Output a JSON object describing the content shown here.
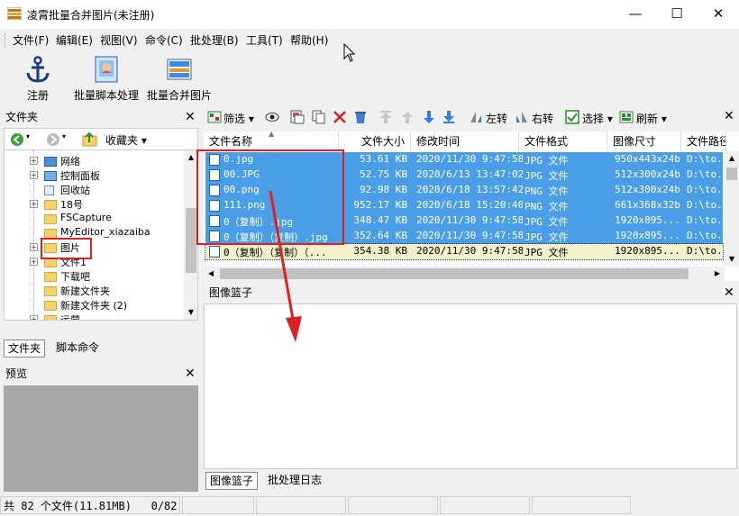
{
  "window": {
    "title": "凌霄批量合并图片(未注册)",
    "minimize": "—",
    "maximize": "☐",
    "close": "✕"
  },
  "menu": [
    "文件(F)",
    "编辑(E)",
    "视图(V)",
    "命令(C)",
    "批处理(B)",
    "工具(T)",
    "帮助(H)"
  ],
  "big_toolbar": {
    "register": "注册",
    "batch_script": "批量脚本处理",
    "batch_merge": "批量合并图片"
  },
  "folder_panel": {
    "title": "文件夹",
    "tree": [
      {
        "label": "网络",
        "expandable": true,
        "icon": "network-icon"
      },
      {
        "label": "控制面板",
        "expandable": true,
        "icon": "control-panel-icon"
      },
      {
        "label": "回收站",
        "expandable": false,
        "icon": "recycle-bin-icon"
      },
      {
        "label": "18号",
        "expandable": true,
        "icon": "folder-icon"
      },
      {
        "label": "FSCapture",
        "expandable": false,
        "icon": "folder-icon"
      },
      {
        "label": "MyEditor_xiazaiba",
        "expandable": false,
        "icon": "folder-icon"
      },
      {
        "label": "图片",
        "expandable": true,
        "icon": "folder-icon"
      },
      {
        "label": "文件1",
        "expandable": true,
        "icon": "folder-icon"
      },
      {
        "label": "下载吧",
        "expandable": false,
        "icon": "folder-icon"
      },
      {
        "label": "新建文件夹",
        "expandable": false,
        "icon": "folder-icon"
      },
      {
        "label": "新建文件夹 (2)",
        "expandable": false,
        "icon": "folder-icon"
      },
      {
        "label": "运营",
        "expandable": true,
        "icon": "folder-icon"
      }
    ],
    "tabs": [
      "文件夹",
      "脚本命令"
    ]
  },
  "preview_panel": {
    "title": "预览"
  },
  "file_toolbar": {
    "filter": "筛选",
    "rotate_left": "左转",
    "rotate_right": "右转",
    "select": "选择",
    "refresh": "刷新"
  },
  "file_list": {
    "columns": [
      "文件名称",
      "文件大小",
      "修改时间",
      "文件格式",
      "图像尺寸",
      "文件路径"
    ],
    "rows": [
      {
        "name": "0.jpg",
        "size": "53.61 KB",
        "modified": "2020/11/30 9:47:58",
        "format": "JPG 文件",
        "dims": "950x443x24b",
        "path": "D:\\to...",
        "state": "selected"
      },
      {
        "name": "00.JPG",
        "size": "52.75 KB",
        "modified": "2020/6/13 13:47:02",
        "format": "JPG 文件",
        "dims": "512x300x24b",
        "path": "D:\\to...",
        "state": "selected"
      },
      {
        "name": "00.png",
        "size": "92.98 KB",
        "modified": "2020/6/18 13:57:42",
        "format": "PNG 文件",
        "dims": "512x300x24b",
        "path": "D:\\to...",
        "state": "selected"
      },
      {
        "name": "111.png",
        "size": "952.17 KB",
        "modified": "2020/6/18 15:20:40",
        "format": "PNG 文件",
        "dims": "661x368x32b",
        "path": "D:\\to...",
        "state": "selected"
      },
      {
        "name": "0（复制）.jpg",
        "size": "348.47 KB",
        "modified": "2020/11/30 9:47:58",
        "format": "JPG 文件",
        "dims": "1920x895...",
        "path": "D:\\to...",
        "state": "selected"
      },
      {
        "name": "0（复制）（复制）.jpg",
        "size": "352.64 KB",
        "modified": "2020/11/30 9:47:58",
        "format": "JPG 文件",
        "dims": "1920x895...",
        "path": "D:\\to...",
        "state": "selected"
      },
      {
        "name": "0（复制）（复制）（...",
        "size": "354.38 KB",
        "modified": "2020/11/30 9:47:58",
        "format": "JPG 文件",
        "dims": "1920x895...",
        "path": "D:\\to...",
        "state": "focused"
      }
    ]
  },
  "basket_panel": {
    "title": "图像篮子",
    "tabs": [
      "图像篮子",
      "批处理日志"
    ]
  },
  "status_bar": {
    "count": "共 82 个文件(11.81MB)",
    "selection": "0/82"
  },
  "colors": {
    "selection": "#4a9ee8",
    "highlight_box": "#e02020",
    "arrow": "#e02020"
  }
}
